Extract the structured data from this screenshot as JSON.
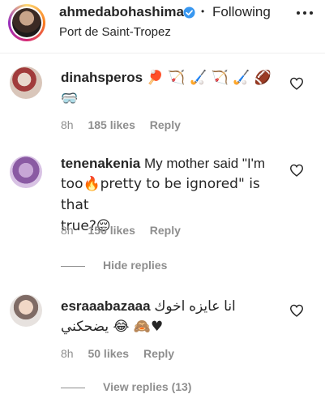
{
  "header": {
    "username": "ahmedabohashima",
    "separator": "•",
    "following_label": "Following",
    "location": "Port de Saint-Tropez"
  },
  "comments": [
    {
      "username": "dinahsperos",
      "text_line1": "🏓 🏹 🏑 🏹 🏑 🏈",
      "text_line2": "🥽",
      "time": "8h",
      "likes": "185 likes",
      "reply": "Reply"
    },
    {
      "username": "tenenakenia",
      "text_line1": "My mother said \"I'm",
      "text_line2": "too🔥pretty to be ignored\" is that",
      "text_line3": "true?😔",
      "time": "8h",
      "likes": "156 likes",
      "reply": "Reply",
      "hide_replies": "Hide replies"
    },
    {
      "username": "esraaabazaaa",
      "text_line1": "انا عايزه اخوك",
      "text_line2": "يضحكني 😂 🙈♥",
      "time": "8h",
      "likes": "50 likes",
      "reply": "Reply",
      "view_replies": "View replies (13)"
    }
  ],
  "colors": {
    "text": "#262626",
    "muted": "#8e8e8e",
    "verified": "#3897f0"
  },
  "icons": [
    "verified-badge-icon",
    "more-options-icon",
    "heart-icon"
  ]
}
